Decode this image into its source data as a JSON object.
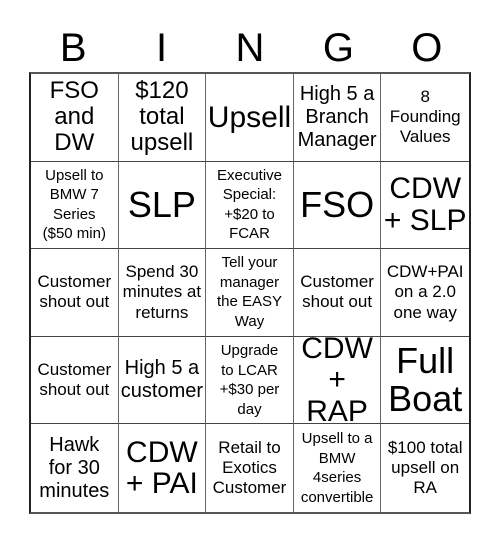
{
  "header": {
    "letters": [
      "B",
      "I",
      "N",
      "G",
      "O"
    ]
  },
  "cells": [
    {
      "text": "FSO\nand\nDW",
      "size": "ml"
    },
    {
      "text": "$120\ntotal\nupsell",
      "size": "ml"
    },
    {
      "text": "Upsell",
      "size": "l"
    },
    {
      "text": "High 5 a\nBranch\nManager",
      "size": "m"
    },
    {
      "text": "8\nFounding\nValues",
      "size": "s"
    },
    {
      "text": "Upsell to\nBMW 7\nSeries\n($50 min)",
      "size": "xs"
    },
    {
      "text": "SLP",
      "size": "xl"
    },
    {
      "text": "Executive\nSpecial:\n+$20 to\nFCAR",
      "size": "xs"
    },
    {
      "text": "FSO",
      "size": "xl"
    },
    {
      "text": "CDW\n+ SLP",
      "size": "l"
    },
    {
      "text": "Customer\nshout out",
      "size": "s"
    },
    {
      "text": "Spend 30\nminutes at\nreturns",
      "size": "s"
    },
    {
      "text": "Tell your\nmanager\nthe EASY\nWay",
      "size": "xs"
    },
    {
      "text": "Customer\nshout out",
      "size": "s"
    },
    {
      "text": "CDW+PAI\non a 2.0\none way",
      "size": "s"
    },
    {
      "text": "Customer\nshout out",
      "size": "s"
    },
    {
      "text": "High 5 a\ncustomer",
      "size": "m"
    },
    {
      "text": "Upgrade\nto LCAR\n+$30 per\nday",
      "size": "xs"
    },
    {
      "text": "CDW\n+ RAP",
      "size": "l"
    },
    {
      "text": "Full\nBoat",
      "size": "xl"
    },
    {
      "text": "Hawk\nfor 30\nminutes",
      "size": "m"
    },
    {
      "text": "CDW\n+ PAI",
      "size": "l"
    },
    {
      "text": "Retail to\nExotics\nCustomer",
      "size": "s"
    },
    {
      "text": "Upsell to a\nBMW\n4series\nconvertible",
      "size": "xs"
    },
    {
      "text": "$100 total\nupsell on\nRA",
      "size": "s"
    }
  ]
}
